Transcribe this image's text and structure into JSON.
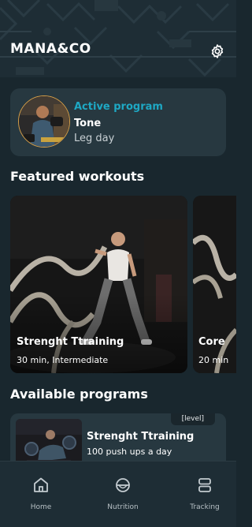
{
  "header": {
    "brand": "MANA&CO",
    "settings_icon": "gear-icon"
  },
  "active_program": {
    "label": "Active program",
    "name": "Tone",
    "subtitle": "Leg day",
    "accent": "#1ea8c4"
  },
  "featured": {
    "title": "Featured workouts",
    "cards": [
      {
        "title": "Strenght Ttraining",
        "meta": "30 min, Intermediate"
      },
      {
        "title": "Core",
        "meta": "20 min"
      }
    ]
  },
  "programs": {
    "title": "Available programs",
    "items": [
      {
        "badge": "[level]",
        "title": "Strenght Ttraining",
        "subtitle": "100 push ups a day"
      }
    ]
  },
  "nav": {
    "items": [
      {
        "label": "Home",
        "icon": "home-icon"
      },
      {
        "label": "Nutrition",
        "icon": "nutrition-bowl-icon"
      },
      {
        "label": "Tracking",
        "icon": "tracking-icon"
      }
    ]
  }
}
